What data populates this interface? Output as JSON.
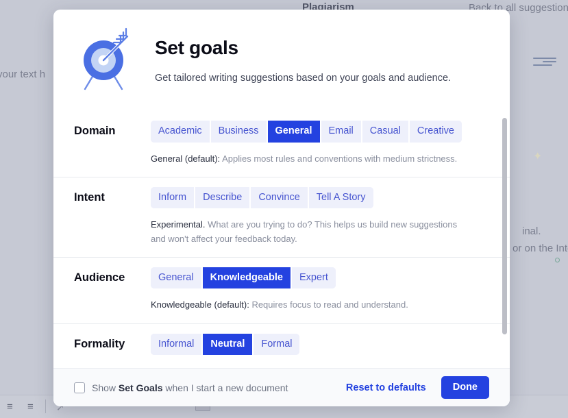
{
  "background": {
    "top_left_text": "your text h",
    "plagiarism_label": "Plagiarism",
    "back_link": "Back to all suggestions",
    "right_text_1": "inal.",
    "right_text_2": "or on the Inte",
    "toolbar_icons": [
      "numbered-list-icon",
      "bullet-list-icon",
      "cursor-icon"
    ]
  },
  "modal": {
    "icon": "target-goal-icon",
    "title": "Set goals",
    "subtitle": "Get tailored writing suggestions based on your goals and audience.",
    "sections": [
      {
        "label": "Domain",
        "name": "domain",
        "options": [
          "Academic",
          "Business",
          "General",
          "Email",
          "Casual",
          "Creative"
        ],
        "selected": "General",
        "description_lead": "General (default):",
        "description_rest": " Applies most rules and conventions with medium strictness."
      },
      {
        "label": "Intent",
        "name": "intent",
        "options": [
          "Inform",
          "Describe",
          "Convince",
          "Tell A Story"
        ],
        "selected": null,
        "description_lead": "Experimental.",
        "description_rest": " What are you trying to do? This helps us build new suggestions and won't affect your feedback today."
      },
      {
        "label": "Audience",
        "name": "audience",
        "options": [
          "General",
          "Knowledgeable",
          "Expert"
        ],
        "selected": "Knowledgeable",
        "description_lead": "Knowledgeable (default):",
        "description_rest": " Requires focus to read and understand."
      },
      {
        "label": "Formality",
        "name": "formality",
        "options": [
          "Informal",
          "Neutral",
          "Formal"
        ],
        "selected": "Neutral",
        "description_lead": "",
        "description_rest": ""
      }
    ],
    "footer": {
      "checkbox_checked": false,
      "checkbox_text_pre": "Show ",
      "checkbox_text_bold": "Set Goals",
      "checkbox_text_post": " when I start a new document",
      "reset_label": "Reset to defaults",
      "done_label": "Done"
    }
  },
  "colors": {
    "accent": "#2442e0",
    "pill_bg": "#eef0fb",
    "pill_text": "#4654d0",
    "overlay": "#c6c9d4"
  }
}
